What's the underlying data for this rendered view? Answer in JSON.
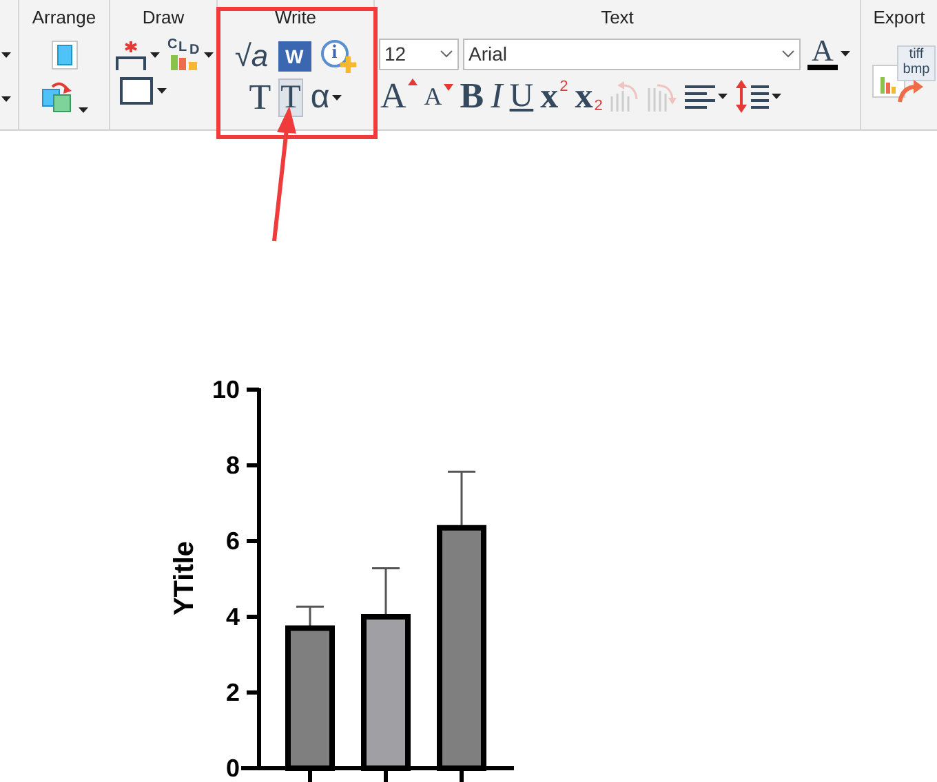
{
  "arrange": {
    "label": "Arrange"
  },
  "draw": {
    "label": "Draw",
    "cld_letters": [
      "C",
      "L",
      "D"
    ]
  },
  "write": {
    "label": "Write",
    "tools": [
      {
        "kind": "equation",
        "symbol": "√a",
        "selected": false
      },
      {
        "kind": "word",
        "symbol": "W",
        "selected": false
      },
      {
        "kind": "info",
        "symbol": "i",
        "selected": false
      },
      {
        "kind": "text",
        "symbol": "T",
        "selected": false
      },
      {
        "kind": "text-box",
        "symbol": "T",
        "selected": true
      },
      {
        "kind": "greek",
        "symbol": "α",
        "selected": false
      }
    ]
  },
  "text": {
    "label": "Text",
    "font_size": "12",
    "font": "Arial",
    "color_symbol": "A",
    "tools": [
      {
        "kind": "larger",
        "symbol": "A",
        "disabled": false
      },
      {
        "kind": "smaller",
        "symbol": "A",
        "disabled": false
      },
      {
        "kind": "bold",
        "symbol": "B",
        "disabled": false
      },
      {
        "kind": "italic",
        "symbol": "I",
        "disabled": false
      },
      {
        "kind": "underline",
        "symbol": "U",
        "disabled": false
      },
      {
        "kind": "superscript",
        "symbol": "x",
        "mark": "2",
        "disabled": false
      },
      {
        "kind": "subscript",
        "symbol": "x",
        "mark": "2",
        "disabled": false
      },
      {
        "kind": "rotate-left",
        "disabled": true
      },
      {
        "kind": "rotate-right",
        "disabled": true
      },
      {
        "kind": "align",
        "disabled": false
      },
      {
        "kind": "line-spacing",
        "disabled": false
      }
    ]
  },
  "export": {
    "label": "Export",
    "file_types": [
      "tiff",
      "bmp"
    ]
  },
  "graph": {
    "chart_data": {
      "type": "bar",
      "ylabel": "YTitle",
      "ylim": [
        0,
        10
      ],
      "yticks": [
        0,
        2,
        4,
        6,
        8,
        10
      ],
      "values": [
        3.7,
        4.0,
        6.35
      ],
      "colors": [
        "#7f7f7f",
        "#a0a0a4",
        "#7f7f7f"
      ],
      "errors": [
        0.57,
        1.28,
        1.48
      ]
    }
  }
}
